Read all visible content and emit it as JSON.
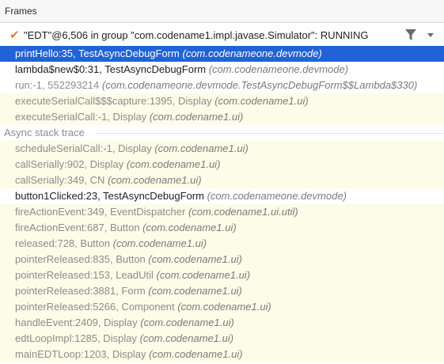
{
  "panel": {
    "title": "Frames"
  },
  "thread": {
    "label": "\"EDT\"@6,506 in group \"com.codename1.impl.javase.Simulator\": RUNNING"
  },
  "frames": [
    {
      "method": "printHello:35, TestAsyncDebugForm",
      "cls": "(com.codenameone.devmode)",
      "style": "selected"
    },
    {
      "method": "lambda$new$0:31, TestAsyncDebugForm",
      "cls": "(com.codenameone.devmode)",
      "style": "app"
    },
    {
      "method": "run:-1, 552293214",
      "cls": "(com.codenameone.devmode.TestAsyncDebugForm$$Lambda$330)",
      "style": "gray"
    },
    {
      "method": "executeSerialCall$$$capture:1395, Display",
      "cls": "(com.codename1.ui)",
      "style": "lib"
    },
    {
      "method": "executeSerialCall:-1, Display",
      "cls": "(com.codename1.ui)",
      "style": "lib"
    }
  ],
  "async_label": "Async stack trace",
  "async_frames": [
    {
      "method": "scheduleSerialCall:-1, Display",
      "cls": "(com.codename1.ui)",
      "style": "lib"
    },
    {
      "method": "callSerially:902, Display",
      "cls": "(com.codename1.ui)",
      "style": "lib"
    },
    {
      "method": "callSerially:349, CN",
      "cls": "(com.codename1.ui)",
      "style": "lib"
    },
    {
      "method": "button1Clicked:23, TestAsyncDebugForm",
      "cls": "(com.codenameone.devmode)",
      "style": "app"
    },
    {
      "method": "fireActionEvent:349, EventDispatcher",
      "cls": "(com.codename1.ui.util)",
      "style": "lib"
    },
    {
      "method": "fireActionEvent:687, Button",
      "cls": "(com.codename1.ui)",
      "style": "lib"
    },
    {
      "method": "released:728, Button",
      "cls": "(com.codename1.ui)",
      "style": "lib"
    },
    {
      "method": "pointerReleased:835, Button",
      "cls": "(com.codename1.ui)",
      "style": "lib"
    },
    {
      "method": "pointerReleased:153, LeadUtil",
      "cls": "(com.codename1.ui)",
      "style": "lib"
    },
    {
      "method": "pointerReleased:3881, Form",
      "cls": "(com.codename1.ui)",
      "style": "lib"
    },
    {
      "method": "pointerReleased:5266, Component",
      "cls": "(com.codename1.ui)",
      "style": "lib"
    },
    {
      "method": "handleEvent:2409, Display",
      "cls": "(com.codename1.ui)",
      "style": "lib"
    },
    {
      "method": "edtLoopImpl:1285, Display",
      "cls": "(com.codename1.ui)",
      "style": "lib"
    },
    {
      "method": "mainEDTLoop:1203, Display",
      "cls": "(com.codename1.ui)",
      "style": "lib"
    }
  ],
  "icons": {
    "check": "checkmark-icon",
    "filter": "filter-icon",
    "dropdown": "dropdown-icon"
  },
  "colors": {
    "selection": "#2162d6",
    "library_row": "#fcfce8",
    "check": "#e07b39"
  }
}
